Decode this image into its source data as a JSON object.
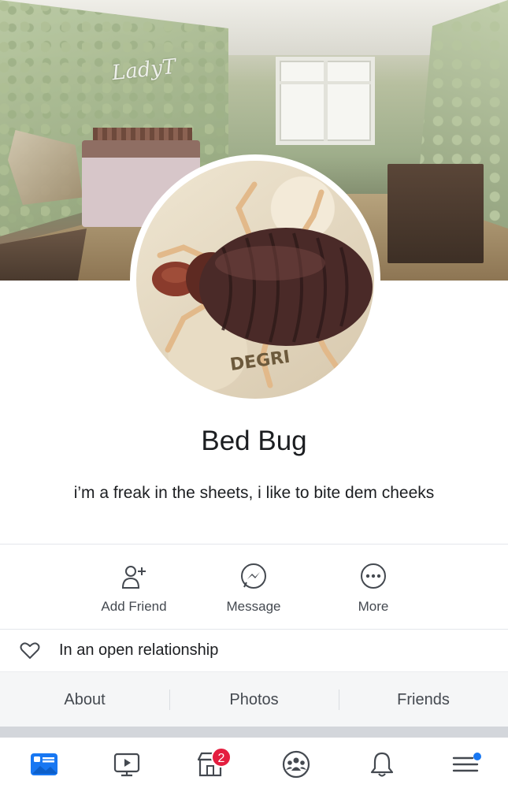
{
  "cover": {
    "signature": "LadyT"
  },
  "profile": {
    "name": "Bed Bug",
    "bio": "i’m a freak in the sheets, i like to bite dem cheeks"
  },
  "actions": [
    {
      "label": "Add Friend",
      "icon": "add-friend-icon"
    },
    {
      "label": "Message",
      "icon": "messenger-icon"
    },
    {
      "label": "More",
      "icon": "more-icon"
    }
  ],
  "relationship": {
    "text": "In an open relationship",
    "icon": "heart-icon"
  },
  "tabs": [
    {
      "label": "About"
    },
    {
      "label": "Photos"
    },
    {
      "label": "Friends"
    }
  ],
  "bottom_nav": {
    "items": [
      {
        "icon": "news-feed-icon"
      },
      {
        "icon": "watch-icon"
      },
      {
        "icon": "marketplace-icon"
      },
      {
        "icon": "groups-icon"
      },
      {
        "icon": "notifications-bell-icon"
      },
      {
        "icon": "menu-icon"
      }
    ],
    "marketplace_badge": "2"
  },
  "colors": {
    "accent": "#1877f2",
    "badge": "#e41e3f",
    "text": "#1c1e21",
    "secondary_text": "#444950"
  }
}
